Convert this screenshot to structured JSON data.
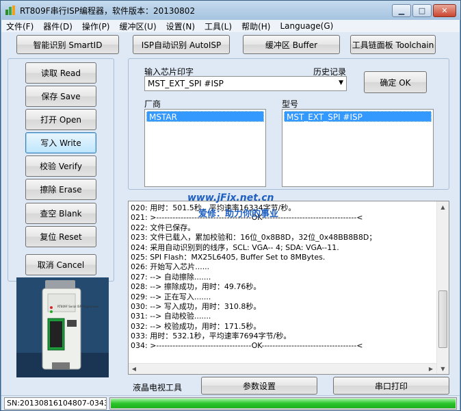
{
  "window": {
    "title": "RT809F串行ISP编程器，软件版本：20130802",
    "minimize_label": "▁",
    "maximize_label": "□",
    "close_label": "✕"
  },
  "menu": [
    "文件(F)",
    "器件(D)",
    "操作(P)",
    "缓冲区(U)",
    "设置(N)",
    "工具(L)",
    "帮助(H)",
    "Language(G)"
  ],
  "toolbar": {
    "smartid": "智能识别 SmartID",
    "autoisp": "ISP自动识别 AutoISP",
    "buffer": "缓冲区 Buffer",
    "toolchain": "工具链面板 Toolchain"
  },
  "left_buttons": {
    "read": "读取 Read",
    "save": "保存 Save",
    "open": "打开 Open",
    "write": "写入 Write",
    "verify": "校验 Verify",
    "erase": "擦除 Erase",
    "blank": "查空 Blank",
    "reset": "复位 Reset",
    "cancel": "取消 Cancel"
  },
  "chip": {
    "input_label": "输入芯片印字",
    "history_label": "历史记录",
    "combo_value": "MST_EXT_SPI #ISP",
    "ok_button": "确定 OK",
    "vendor_label": "厂商",
    "vendor_selected": "MSTAR",
    "model_label": "型号",
    "model_selected": "MST_EXT_SPI #ISP"
  },
  "log": [
    "020: 用时：501.5秒，平均速率16334字节/秒。",
    "021: >-----------------------------------OK-----------------------------------<",
    "022: 文件已保存。",
    "023: 文件已载入，累加校验和：16位_0x8B8D，32位_0x48BB8B8D；",
    "024: 采用自动识别到的线序，SCL: VGA-- 4; SDA: VGA--11.",
    "025: SPI Flash：MX25L6405, Buffer Set to 8MBytes.",
    "026: 开始写入芯片......",
    "027: --> 自动擦除.......",
    "028: --> 擦除成功，用时：49.76秒。",
    "029: --> 正在写入.......",
    "030: --> 写入成功，用时：310.8秒。",
    "031: --> 自动校验.......",
    "032: --> 校验成功，用时：171.5秒。",
    "033: 用时：532.1秒，平均速率7694字节/秒。",
    "034: >-----------------------------------OK-----------------------------------<"
  ],
  "watermark": {
    "url": "www.jFix.net.cn",
    "text": "爱修：助力你的事业"
  },
  "bottom_tabs": {
    "lcd_tool": "液晶电视工具",
    "params": "参数设置",
    "serial": "串口打印"
  },
  "device": {
    "model_text": "RT809F Serial ISP Programmer"
  },
  "status": {
    "sn": "SN:20130816104807-0343",
    "progress": 1.0
  },
  "colors": {
    "accent": "#3399ff",
    "progress": "#2bc42b",
    "close": "#c9452f"
  }
}
